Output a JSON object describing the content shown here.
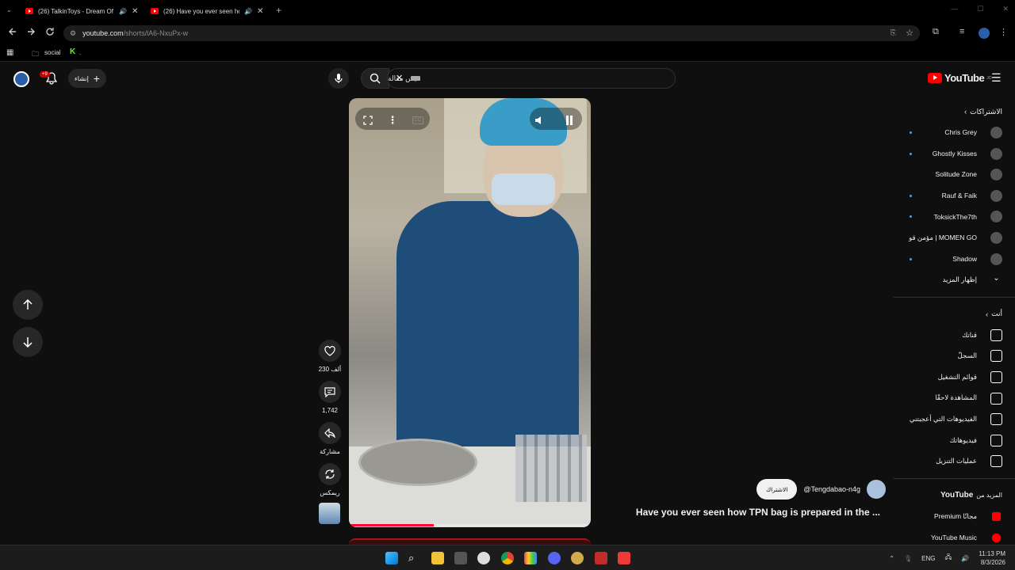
{
  "browser": {
    "tabs": [
      {
        "title": "(26) TalkinToys - Dream Of"
      },
      {
        "title": "(26) Have you ever seen ho"
      }
    ],
    "url_host": "youtube.com",
    "url_path": "/shorts/lA6-NxuPx-w",
    "bookmarks": [
      {
        "label": "social"
      },
      {
        "label": "."
      }
    ]
  },
  "header": {
    "logo_text": "YouTube",
    "logo_country": "JO",
    "search_placeholder": "ميس مقالة",
    "create_label": "إنشاء",
    "notification_count": "+9"
  },
  "sidebar": {
    "subscriptions_title": "الاشتراكات",
    "subscriptions": [
      {
        "name": "Chris Grey",
        "icon": "avatar",
        "dot": true
      },
      {
        "name": "Ghostly Kisses",
        "icon": "avatar",
        "dot": true
      },
      {
        "name": "Solitude Zone",
        "icon": "avatar",
        "dot": false
      },
      {
        "name": "Rauf & Faik",
        "icon": "avatar",
        "dot": true
      },
      {
        "name": "ToksickThe7th",
        "icon": "avatar",
        "dot": true
      },
      {
        "name": "مؤمن قو | MOMEN GO",
        "icon": "avatar",
        "dot": false
      },
      {
        "name": "Shadow",
        "icon": "avatar",
        "dot": true
      }
    ],
    "show_more": "إظهار المزيد",
    "you_title": "أنت",
    "you_items": [
      {
        "label": "قناتك",
        "icon": "channel-icon"
      },
      {
        "label": "السجلّ",
        "icon": "history-icon"
      },
      {
        "label": "قوائم التشغيل",
        "icon": "playlists-icon"
      },
      {
        "label": "المشاهدة لاحقًا",
        "icon": "watch-later-icon"
      },
      {
        "label": "الفيديوهات التي أعجبتني",
        "icon": "liked-icon"
      },
      {
        "label": "فيديوهاتك",
        "icon": "your-videos-icon"
      },
      {
        "label": "عمليات التنزيل",
        "icon": "downloads-icon"
      }
    ],
    "more_title_prefix": "المزيد من",
    "more_title_brand": "YouTube",
    "more_items": [
      {
        "label": "Premium مجانًا",
        "icon": "premium-icon"
      },
      {
        "label": "YouTube Music",
        "icon": "music-icon"
      }
    ]
  },
  "short": {
    "likes": "230 ألف",
    "comments": "1,742",
    "share_label": "مشاركة",
    "remix_label": "ريمكس",
    "channel": "@Tengdabao-n4g",
    "subscribe_label": "الاشتراك",
    "title": "Have you ever seen how TPN bag is prepared in the ...",
    "progress": 0.35
  },
  "taskbar": {
    "language": "ENG",
    "time": "11:13 PM",
    "date": "8/3/2026"
  },
  "colors": {
    "accent": "#ff0000",
    "background": "#0f0f0f",
    "link": "#3ea6ff"
  }
}
